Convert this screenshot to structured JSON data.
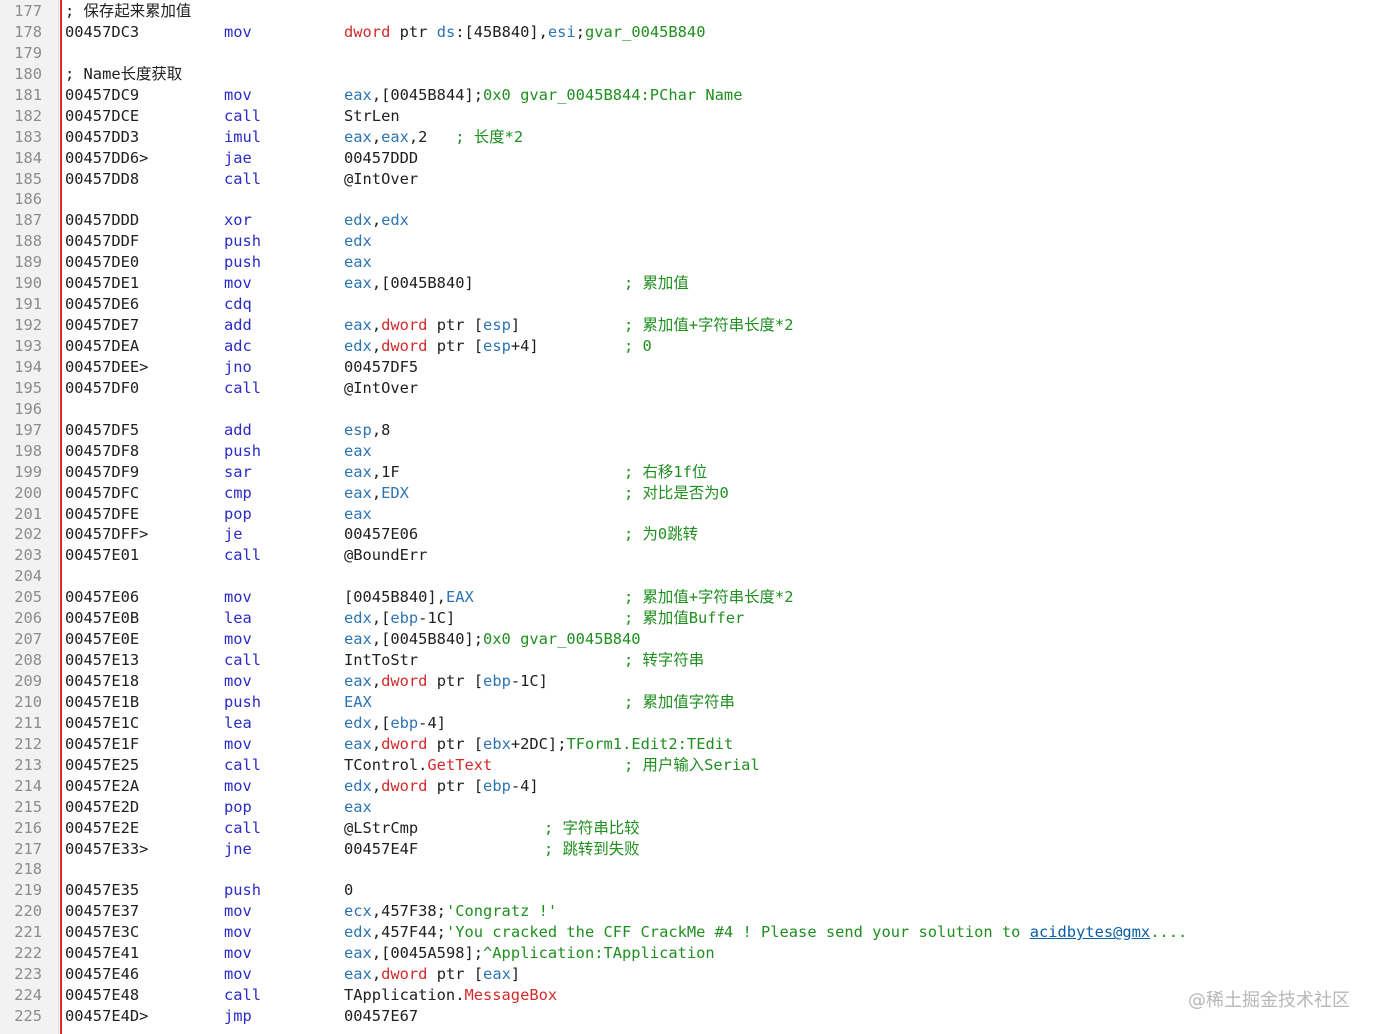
{
  "lines": [
    {
      "n": "177",
      "kind": "comment",
      "text": "; 保存起来累加值"
    },
    {
      "n": "178",
      "addr": "00457DC3",
      "op": "mov",
      "args": [
        [
          "kw",
          "dword"
        ],
        [
          "t",
          " ptr "
        ],
        [
          "reg",
          "ds"
        ],
        [
          "t",
          ":[45B840],"
        ],
        [
          "reg",
          "esi"
        ],
        [
          "t",
          ";"
        ],
        [
          "cm",
          "gvar_0045B840"
        ]
      ]
    },
    {
      "n": "179",
      "kind": "blank"
    },
    {
      "n": "180",
      "kind": "comment",
      "text": "; Name长度获取"
    },
    {
      "n": "181",
      "addr": "00457DC9",
      "op": "mov",
      "args": [
        [
          "reg",
          "eax"
        ],
        [
          "t",
          ",[0045B844];"
        ],
        [
          "cm",
          "0x0 gvar_0045B844:PChar Name"
        ]
      ]
    },
    {
      "n": "182",
      "addr": "00457DCE",
      "op": "call",
      "args": [
        [
          "t",
          "StrLen"
        ]
      ]
    },
    {
      "n": "183",
      "addr": "00457DD3",
      "op": "imul",
      "args": [
        [
          "reg",
          "eax"
        ],
        [
          "t",
          ","
        ],
        [
          "reg",
          "eax"
        ],
        [
          "t",
          ",2   "
        ],
        [
          "cm",
          "; 长度*2"
        ]
      ]
    },
    {
      "n": "184",
      "addr": "00457DD6>",
      "op": "jae",
      "args": [
        [
          "t",
          "00457DDD"
        ]
      ]
    },
    {
      "n": "185",
      "addr": "00457DD8",
      "op": "call",
      "args": [
        [
          "t",
          "@IntOver"
        ]
      ]
    },
    {
      "n": "186",
      "kind": "blank"
    },
    {
      "n": "187",
      "addr": "00457DDD",
      "op": "xor",
      "args": [
        [
          "reg",
          "edx"
        ],
        [
          "t",
          ","
        ],
        [
          "reg",
          "edx"
        ]
      ]
    },
    {
      "n": "188",
      "addr": "00457DDF",
      "op": "push",
      "args": [
        [
          "reg",
          "edx"
        ]
      ]
    },
    {
      "n": "189",
      "addr": "00457DE0",
      "op": "push",
      "args": [
        [
          "reg",
          "eax"
        ]
      ]
    },
    {
      "n": "190",
      "addr": "00457DE1",
      "op": "mov",
      "args": [
        [
          "reg",
          "eax"
        ],
        [
          "t",
          ",[0045B840]"
        ]
      ],
      "cmt": "; 累加值"
    },
    {
      "n": "191",
      "addr": "00457DE6",
      "op": "cdq",
      "args": []
    },
    {
      "n": "192",
      "addr": "00457DE7",
      "op": "add",
      "args": [
        [
          "reg",
          "eax"
        ],
        [
          "t",
          ","
        ],
        [
          "kw",
          "dword"
        ],
        [
          "t",
          " ptr ["
        ],
        [
          "reg",
          "esp"
        ],
        [
          "t",
          "]"
        ]
      ],
      "cmt": "; 累加值+字符串长度*2"
    },
    {
      "n": "193",
      "addr": "00457DEA",
      "op": "adc",
      "args": [
        [
          "reg",
          "edx"
        ],
        [
          "t",
          ","
        ],
        [
          "kw",
          "dword"
        ],
        [
          "t",
          " ptr ["
        ],
        [
          "reg",
          "esp"
        ],
        [
          "t",
          "+4]"
        ]
      ],
      "cmt": "; 0"
    },
    {
      "n": "194",
      "addr": "00457DEE>",
      "op": "jno",
      "args": [
        [
          "t",
          "00457DF5"
        ]
      ]
    },
    {
      "n": "195",
      "addr": "00457DF0",
      "op": "call",
      "args": [
        [
          "t",
          "@IntOver"
        ]
      ]
    },
    {
      "n": "196",
      "kind": "blank"
    },
    {
      "n": "197",
      "addr": "00457DF5",
      "op": "add",
      "args": [
        [
          "reg",
          "esp"
        ],
        [
          "t",
          ",8"
        ]
      ]
    },
    {
      "n": "198",
      "addr": "00457DF8",
      "op": "push",
      "args": [
        [
          "reg",
          "eax"
        ]
      ]
    },
    {
      "n": "199",
      "addr": "00457DF9",
      "op": "sar",
      "args": [
        [
          "reg",
          "eax"
        ],
        [
          "t",
          ",1F"
        ]
      ],
      "cmt": "; 右移1f位"
    },
    {
      "n": "200",
      "addr": "00457DFC",
      "op": "cmp",
      "args": [
        [
          "reg",
          "eax"
        ],
        [
          "t",
          ","
        ],
        [
          "reg",
          "EDX"
        ]
      ],
      "cmt": "; 对比是否为0"
    },
    {
      "n": "201",
      "addr": "00457DFE",
      "op": "pop",
      "args": [
        [
          "reg",
          "eax"
        ]
      ]
    },
    {
      "n": "202",
      "addr": "00457DFF>",
      "op": "je",
      "args": [
        [
          "t",
          "00457E06"
        ]
      ],
      "cmt": "; 为0跳转"
    },
    {
      "n": "203",
      "addr": "00457E01",
      "op": "call",
      "args": [
        [
          "t",
          "@BoundErr"
        ]
      ]
    },
    {
      "n": "204",
      "kind": "blank"
    },
    {
      "n": "205",
      "addr": "00457E06",
      "op": "mov",
      "args": [
        [
          "t",
          "[0045B840],"
        ],
        [
          "reg",
          "EAX"
        ]
      ],
      "cmt": "; 累加值+字符串长度*2"
    },
    {
      "n": "206",
      "addr": "00457E0B",
      "op": "lea",
      "args": [
        [
          "reg",
          "edx"
        ],
        [
          "t",
          ",["
        ],
        [
          "reg",
          "ebp"
        ],
        [
          "t",
          "-1C]"
        ]
      ],
      "cmt": "; 累加值Buffer"
    },
    {
      "n": "207",
      "addr": "00457E0E",
      "op": "mov",
      "args": [
        [
          "reg",
          "eax"
        ],
        [
          "t",
          ",[0045B840];"
        ],
        [
          "cm",
          "0x0 gvar_0045B840"
        ]
      ]
    },
    {
      "n": "208",
      "addr": "00457E13",
      "op": "call",
      "args": [
        [
          "t",
          "IntToStr"
        ]
      ],
      "cmt": "; 转字符串"
    },
    {
      "n": "209",
      "addr": "00457E18",
      "op": "mov",
      "args": [
        [
          "reg",
          "eax"
        ],
        [
          "t",
          ","
        ],
        [
          "kw",
          "dword"
        ],
        [
          "t",
          " ptr ["
        ],
        [
          "reg",
          "ebp"
        ],
        [
          "t",
          "-1C]"
        ]
      ]
    },
    {
      "n": "210",
      "addr": "00457E1B",
      "op": "push",
      "args": [
        [
          "reg",
          "EAX"
        ]
      ],
      "cmt": "; 累加值字符串"
    },
    {
      "n": "211",
      "addr": "00457E1C",
      "op": "lea",
      "args": [
        [
          "reg",
          "edx"
        ],
        [
          "t",
          ",["
        ],
        [
          "reg",
          "ebp"
        ],
        [
          "t",
          "-4]"
        ]
      ]
    },
    {
      "n": "212",
      "addr": "00457E1F",
      "op": "mov",
      "args": [
        [
          "reg",
          "eax"
        ],
        [
          "t",
          ","
        ],
        [
          "kw",
          "dword"
        ],
        [
          "t",
          " ptr ["
        ],
        [
          "reg",
          "ebx"
        ],
        [
          "t",
          "+2DC];"
        ],
        [
          "cm",
          "TForm1.Edit2:TEdit"
        ]
      ]
    },
    {
      "n": "213",
      "addr": "00457E25",
      "op": "call",
      "args": [
        [
          "t",
          "TControl."
        ],
        [
          "kw",
          "GetText"
        ]
      ],
      "cmt": "; 用户输入Serial"
    },
    {
      "n": "214",
      "addr": "00457E2A",
      "op": "mov",
      "args": [
        [
          "reg",
          "edx"
        ],
        [
          "t",
          ","
        ],
        [
          "kw",
          "dword"
        ],
        [
          "t",
          " ptr ["
        ],
        [
          "reg",
          "ebp"
        ],
        [
          "t",
          "-4]"
        ]
      ]
    },
    {
      "n": "215",
      "addr": "00457E2D",
      "op": "pop",
      "args": [
        [
          "reg",
          "eax"
        ]
      ]
    },
    {
      "n": "216",
      "addr": "00457E2E",
      "op": "call",
      "args": [
        [
          "t",
          "@LStrCmp"
        ]
      ],
      "cmt2": "; 字符串比较"
    },
    {
      "n": "217",
      "addr": "00457E33>",
      "op": "jne",
      "args": [
        [
          "t",
          "00457E4F"
        ]
      ],
      "cmt2": "; 跳转到失败"
    },
    {
      "n": "218",
      "kind": "blank"
    },
    {
      "n": "219",
      "addr": "00457E35",
      "op": "push",
      "args": [
        [
          "t",
          "0"
        ]
      ]
    },
    {
      "n": "220",
      "addr": "00457E37",
      "op": "mov",
      "args": [
        [
          "reg",
          "ecx"
        ],
        [
          "t",
          ",457F38;"
        ],
        [
          "cm",
          "'Congratz !'"
        ]
      ]
    },
    {
      "n": "221",
      "addr": "00457E3C",
      "op": "mov",
      "args": [
        [
          "reg",
          "edx"
        ],
        [
          "t",
          ",457F44;"
        ],
        [
          "cm",
          "'You cracked the CFF CrackMe #4 ! Please send your solution to "
        ],
        [
          "link",
          "acidbytes@gmx"
        ],
        [
          "cm",
          "...."
        ]
      ]
    },
    {
      "n": "222",
      "addr": "00457E41",
      "op": "mov",
      "args": [
        [
          "reg",
          "eax"
        ],
        [
          "t",
          ",[0045A598];"
        ],
        [
          "cm",
          "^Application:TApplication"
        ]
      ]
    },
    {
      "n": "223",
      "addr": "00457E46",
      "op": "mov",
      "args": [
        [
          "reg",
          "eax"
        ],
        [
          "t",
          ","
        ],
        [
          "kw",
          "dword"
        ],
        [
          "t",
          " ptr ["
        ],
        [
          "reg",
          "eax"
        ],
        [
          "t",
          "]"
        ]
      ]
    },
    {
      "n": "224",
      "addr": "00457E48",
      "op": "call",
      "args": [
        [
          "t",
          "TApplication."
        ],
        [
          "kw",
          "MessageBox"
        ]
      ]
    },
    {
      "n": "225",
      "addr": "00457E4D>",
      "op": "jmp",
      "args": [
        [
          "t",
          "00457E67"
        ]
      ]
    }
  ],
  "watermark": "@稀土掘金技术社区",
  "colors": {
    "comment": "#1f8f1f",
    "opcode": "#2b2bc8",
    "register": "#2d74b3",
    "keyword": "#d42a2a",
    "margin_line": "#e32626"
  }
}
